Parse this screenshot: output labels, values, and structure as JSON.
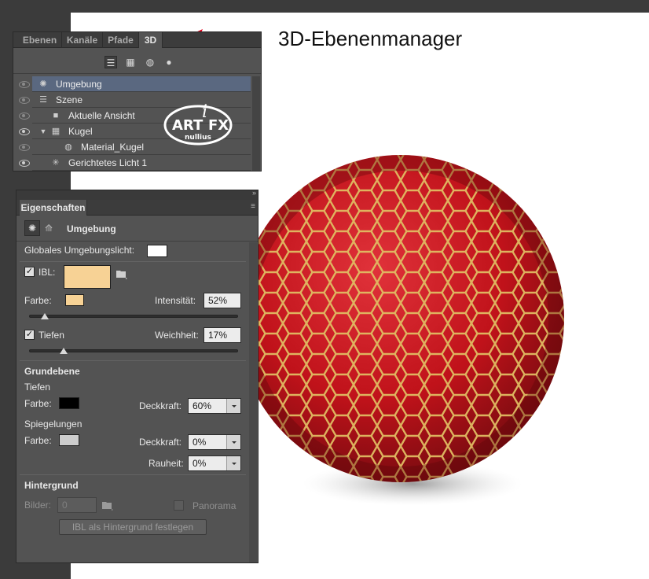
{
  "caption": "3D-Ebenenmanager",
  "layers_panel": {
    "tabs": [
      {
        "label": "Ebenen",
        "active": false
      },
      {
        "label": "Kanäle",
        "active": false
      },
      {
        "label": "Pfade",
        "active": false
      },
      {
        "label": "3D",
        "active": true
      }
    ],
    "toolbar_icons": [
      "scene-filter-icon",
      "mesh-filter-icon",
      "material-filter-icon",
      "light-filter-icon"
    ],
    "rows": [
      {
        "label": "Umgebung",
        "icon": "environment-icon",
        "selected": true,
        "visible": false
      },
      {
        "label": "Szene",
        "icon": "scene-icon",
        "selected": false,
        "visible": false
      },
      {
        "label": "Aktuelle Ansicht",
        "icon": "camera-icon",
        "selected": false,
        "visible": false
      },
      {
        "label": "Kugel",
        "icon": "mesh-icon",
        "selected": false,
        "visible": true,
        "expanded": true
      },
      {
        "label": "Material_Kugel",
        "icon": "material-icon",
        "selected": false,
        "visible": false
      },
      {
        "label": "Gerichtetes Licht 1",
        "icon": "directional-light-icon",
        "selected": false,
        "visible": true
      }
    ],
    "watermark": "ART i FX nullius"
  },
  "properties_panel": {
    "tab": "Eigenschaften",
    "header": "Umgebung",
    "global_ambient_label": "Globales Umgebungslicht:",
    "global_ambient_color": "#ffffff",
    "ibl": {
      "label": "IBL:",
      "checked": true,
      "color": "#f7d295"
    },
    "color_label": "Farbe:",
    "color_swatch": "#f7d295",
    "intensity_label": "Intensität:",
    "intensity_value": "52%",
    "intensity_slider": 0.08,
    "shadows": {
      "label": "Tiefen",
      "checked": true
    },
    "softness_label": "Weichheit:",
    "softness_value": "17%",
    "softness_slider": 0.17,
    "ground_plane": {
      "heading": "Grundebene",
      "shadows_label": "Tiefen",
      "shadows_color_label": "Farbe:",
      "shadows_color": "#000000",
      "opacity_label": "Deckkraft:",
      "shadows_opacity": "60%",
      "reflections_label": "Spiegelungen",
      "reflections_color_label": "Farbe:",
      "reflections_color": "#cccccc",
      "reflections_opacity": "0%",
      "roughness_label": "Rauheit:",
      "roughness_value": "0%"
    },
    "background": {
      "heading": "Hintergrund",
      "images_label": "Bilder:",
      "images_value": "0",
      "panorama_label": "Panorama",
      "ibl_button": "IBL als Hintergrund festlegen"
    }
  },
  "colors": {
    "sphere_red": "#c8141c",
    "sphere_cell_edge": "#d9b25a",
    "selection": "#5a6880",
    "arrow": "#e4001b"
  }
}
